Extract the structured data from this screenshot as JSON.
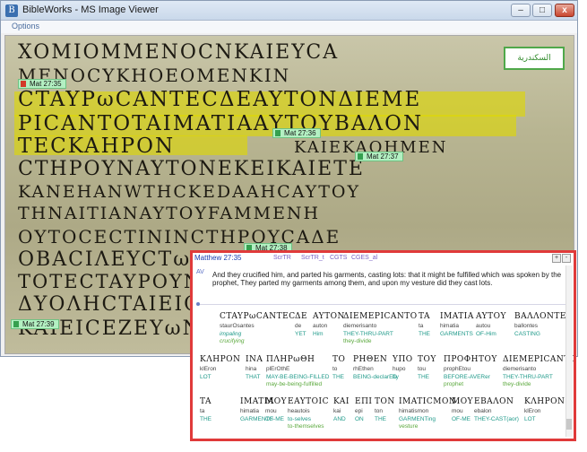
{
  "window": {
    "title": "BibleWorks - MS Image Viewer",
    "menu": [
      "Options"
    ],
    "controls": {
      "minimize": "–",
      "maximize": "□",
      "close": "x"
    }
  },
  "manuscript": {
    "lines": [
      "XOMIOMMENOCNKAIEYCA",
      "MENOCYKHOEOMENKIN",
      "CTAYPωCANTECΔEAYTONΔIEME",
      "PICANTOTAIMATIAAYTOYBAΛON",
      "TECKAHPON",
      "KAIEKAOHMEN",
      "CTHPOYNAYTONEKEIKAIETE",
      "KANEHANWTHCKEDAAHCAYTOY",
      "THNAITIANAYTOYFAMMENH",
      "OYTOCECTININCTHPOYCAΔE",
      "OBACIΛEYCTωNIOYΔAIωN",
      "TOTECTAYPOYNTAICYNAYTω",
      "ΔYOΛHCTAIEICEKΔEΞIωN",
      "KAIEICEZEYωNYMωNEIC"
    ],
    "verse_tags": [
      {
        "label": "Mat 27:35",
        "selected": true
      },
      {
        "label": "Mat 27:36",
        "selected": false
      },
      {
        "label": "Mat 27:37",
        "selected": false
      },
      {
        "label": "Mat 27:38",
        "selected": false
      },
      {
        "label": "Mat 27:39",
        "selected": false
      }
    ],
    "arabic_label": "السكندرية"
  },
  "verse_panel": {
    "reference": "Matthew 27:35",
    "tabs": [
      "ScrTR",
      "ScrTR_t",
      "CGTS",
      "CGES_al"
    ],
    "buttons": {
      "plus": "+",
      "minus": "-"
    },
    "marker": "AV",
    "english": "And they crucified him, and parted his garments, casting lots: that it might be fulfilled which was spoken by the prophet, They parted my garments among them, and upon my vesture did they cast lots.",
    "rows": [
      [
        {
          "greek": "CTAYPωCANTEC",
          "translit": "staurOsantes",
          "gloss": "impaling",
          "gloss2": "crucifying"
        },
        {
          "greek": "ΔE",
          "translit": "de",
          "gloss": "YET",
          "gloss2": ""
        },
        {
          "greek": "AYTON",
          "translit": "auton",
          "gloss": "Him",
          "gloss2": ""
        },
        {
          "greek": "ΔIEMEPICANTO",
          "translit": "diemerisanto",
          "gloss": "THEY-THRU-PART",
          "gloss2": "they-divide"
        },
        {
          "greek": "TA",
          "translit": "ta",
          "gloss": "THE",
          "gloss2": ""
        },
        {
          "greek": "IMATIA",
          "translit": "himatia",
          "gloss": "GARMENTS",
          "gloss2": ""
        },
        {
          "greek": "AYTOY",
          "translit": "autou",
          "gloss": "OF-Him",
          "gloss2": ""
        },
        {
          "greek": "BAΛΛONTEC",
          "translit": "ballontes",
          "gloss": "CASTING",
          "gloss2": ""
        }
      ],
      [
        {
          "greek": "KΛHPON",
          "translit": "klEron",
          "gloss": "LOT",
          "gloss2": ""
        },
        {
          "greek": "INA",
          "translit": "hina",
          "gloss": "THAT",
          "gloss2": ""
        },
        {
          "greek": "ΠΛHPωΘH",
          "translit": "plErOthE",
          "gloss": "MAY-BE-BEING-FILLED",
          "gloss2": "may-be-being-fulfilled"
        },
        {
          "greek": "TO",
          "translit": "to",
          "gloss": "THE",
          "gloss2": ""
        },
        {
          "greek": "PHΘEN",
          "translit": "rhEthen",
          "gloss": "BEING-declarED",
          "gloss2": ""
        },
        {
          "greek": "YΠO",
          "translit": "hupo",
          "gloss": "by",
          "gloss2": ""
        },
        {
          "greek": "TOY",
          "translit": "tou",
          "gloss": "THE",
          "gloss2": ""
        },
        {
          "greek": "ΠPOΦHTOY",
          "translit": "prophEtou",
          "gloss": "BEFORE-AVERer",
          "gloss2": "prophet"
        },
        {
          "greek": "ΔIEMEPICANTO",
          "translit": "diemerisanto",
          "gloss": "THEY-THRU-PART",
          "gloss2": "they-divide"
        }
      ],
      [
        {
          "greek": "TA",
          "translit": "ta",
          "gloss": "THE",
          "gloss2": ""
        },
        {
          "greek": "IMATIA",
          "translit": "himatia",
          "gloss": "GARMENTS",
          "gloss2": ""
        },
        {
          "greek": "MOY",
          "translit": "mou",
          "gloss": "OF-ME",
          "gloss2": ""
        },
        {
          "greek": "EAYTOIC",
          "translit": "heautois",
          "gloss": "to-selves",
          "gloss2": "to-themselves"
        },
        {
          "greek": "KAI",
          "translit": "kai",
          "gloss": "AND",
          "gloss2": ""
        },
        {
          "greek": "EΠI",
          "translit": "epi",
          "gloss": "ON",
          "gloss2": ""
        },
        {
          "greek": "TON",
          "translit": "ton",
          "gloss": "THE",
          "gloss2": ""
        },
        {
          "greek": "IMATICMON",
          "translit": "himatismon",
          "gloss": "GARMENTing",
          "gloss2": "vesture"
        },
        {
          "greek": "MOY",
          "translit": "mou",
          "gloss": "OF-ME",
          "gloss2": ""
        },
        {
          "greek": "EBAΛON",
          "translit": "ebalon",
          "gloss": "THEY-CAST(aor)",
          "gloss2": ""
        },
        {
          "greek": "KΛHPON",
          "translit": "klEron",
          "gloss": "LOT",
          "gloss2": ""
        }
      ]
    ]
  },
  "colors": {
    "highlight": "#ded800",
    "panel_border": "#e03a3a",
    "verse_tag": "#b3f0c2",
    "gloss_teal": "#1f9a8a",
    "gloss_green": "#5aa83c"
  }
}
